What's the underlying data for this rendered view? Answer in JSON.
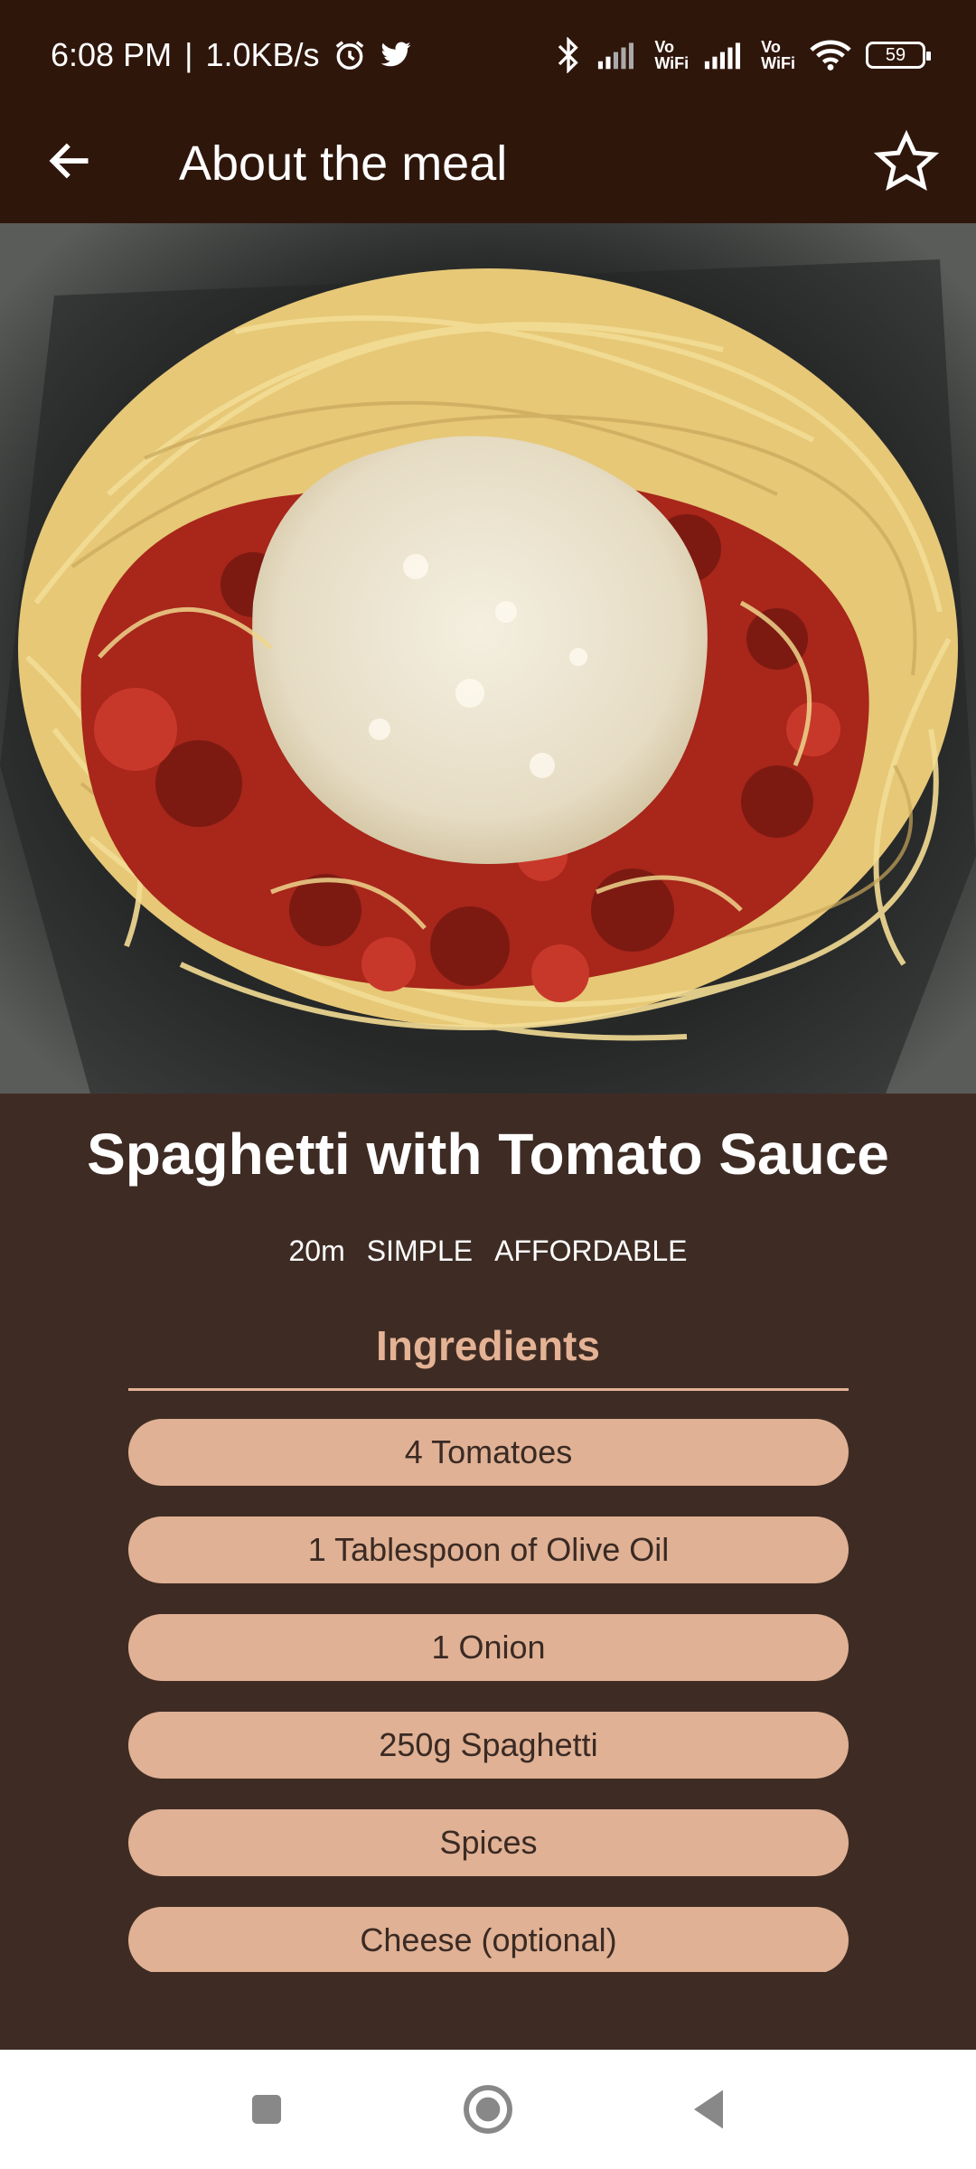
{
  "status_bar": {
    "time": "6:08 PM",
    "separator": "|",
    "speed": "1.0KB/s",
    "vowifi_1_top": "Vo",
    "vowifi_1_bottom": "WiFi",
    "vowifi_2_top": "Vo",
    "vowifi_2_bottom": "WiFi",
    "battery": "59",
    "icons": [
      "alarm-icon",
      "twitter-icon",
      "bluetooth-icon",
      "signal-icon",
      "wifi-icon",
      "battery-icon"
    ]
  },
  "app_bar": {
    "title": "About the meal",
    "back_icon": "arrow-left-icon",
    "favorite_icon": "star-outline-icon"
  },
  "meal": {
    "title": "Spaghetti with Tomato Sauce",
    "duration": "20m",
    "complexity": "SIMPLE",
    "affordability": "AFFORDABLE"
  },
  "ingredients": {
    "title": "Ingredients",
    "items": [
      "4 Tomatoes",
      "1 Tablespoon of Olive Oil",
      "1 Onion",
      "250g Spaghetti",
      "Spices",
      "Cheese (optional)"
    ]
  },
  "nav": {
    "icons": [
      "recents-icon",
      "home-icon",
      "back-icon"
    ]
  },
  "colors": {
    "app_bar": "#2f160b",
    "background": "#3e2c24",
    "accent": "#e4b294",
    "chip": "#e0b194"
  }
}
